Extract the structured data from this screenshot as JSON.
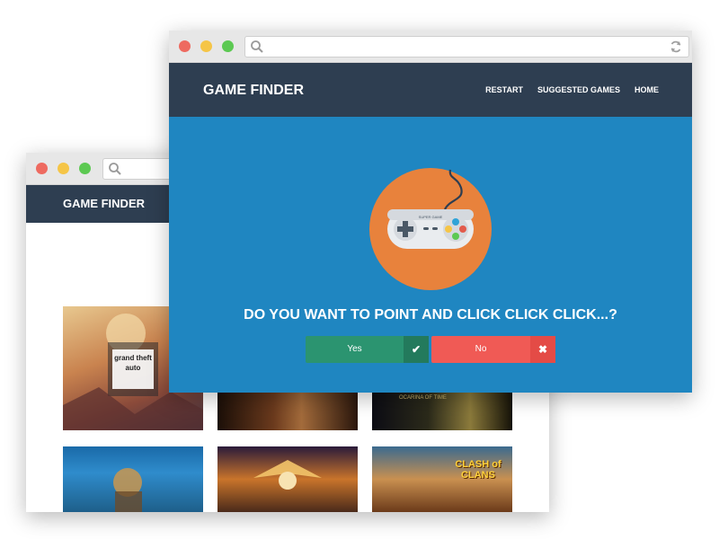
{
  "colors": {
    "nav": "#2e3e51",
    "hero": "#1f86c1",
    "yes": "#2b9470",
    "yes_icon": "#237a5c",
    "no": "#f05a55",
    "no_icon": "#e44b46",
    "controller_circle": "#e8823c",
    "dot_red": "#ee6a60",
    "dot_yellow": "#f5c547",
    "dot_green": "#5cc952"
  },
  "back_window": {
    "brand": "GAME FINDER",
    "thumbnails": [
      {
        "name": "thumb-gta",
        "caption": "grand theft auto"
      },
      {
        "name": "thumb-battle"
      },
      {
        "name": "thumb-zelda",
        "caption": "OCARINA OF TIME"
      },
      {
        "name": "thumb-underwater"
      },
      {
        "name": "thumb-angel"
      },
      {
        "name": "thumb-clash",
        "caption": "CLASH of CLANS"
      }
    ]
  },
  "front_window": {
    "brand": "GAME FINDER",
    "menu": [
      "RESTART",
      "SUGGESTED GAMES",
      "HOME"
    ],
    "controller_label": "SUPER GAME",
    "question": "DO YOU WANT TO POINT AND CLICK CLICK CLICK...?",
    "yes_label": "Yes",
    "no_label": "No",
    "yes_icon": "check-icon",
    "no_icon": "x-icon"
  }
}
